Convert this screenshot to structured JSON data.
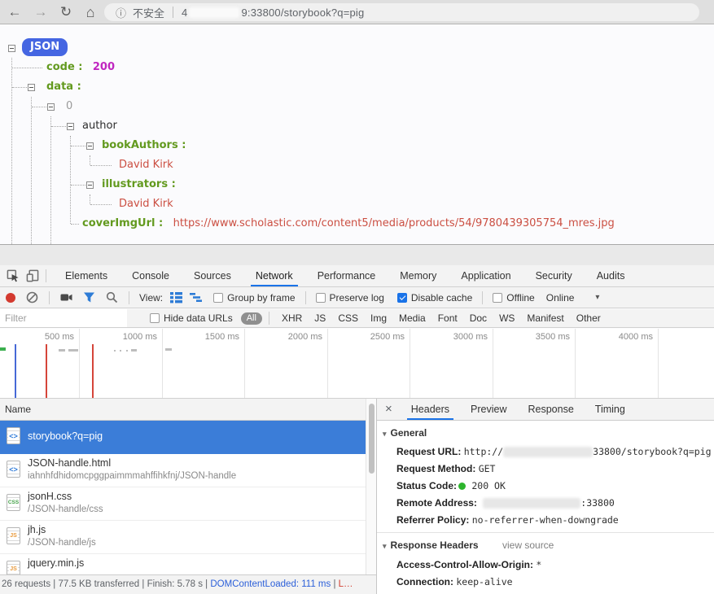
{
  "browser": {
    "security_label": "不安全",
    "url_visible_prefix": "4",
    "url_visible_suffix": "9:33800/storybook?q=pig"
  },
  "icons": {
    "back": "←",
    "forward": "→",
    "reload": "↻",
    "home": "⌂",
    "info": "ⓘ",
    "close": "×",
    "dropdown": "▾",
    "disclosure": "▾"
  },
  "json_tree": {
    "root": "JSON",
    "code_key": "code :",
    "code_value": "200",
    "data_key": "data :",
    "index_key": "0",
    "author_key": "author",
    "book_authors_key": "bookAuthors :",
    "book_authors_value": "David Kirk",
    "illustrators_key": "illustrators :",
    "illustrators_value": "David Kirk",
    "cover_img_key": "coverImgUrl :",
    "cover_img_value": "https://www.scholastic.com/content5/media/products/54/9780439305754_mres.jpg"
  },
  "devtools": {
    "tabs": [
      "Elements",
      "Console",
      "Sources",
      "Network",
      "Performance",
      "Memory",
      "Application",
      "Security",
      "Audits"
    ],
    "active_tab": "Network",
    "network_toolbar": {
      "view_label": "View:",
      "group_by_frame_label": "Group by frame",
      "preserve_log_label": "Preserve log",
      "disable_cache_label": "Disable cache",
      "offline_label": "Offline",
      "throttling_value": "Online"
    },
    "filter_bar": {
      "filter_placeholder": "Filter",
      "hide_data_urls_label": "Hide data URLs",
      "all_label": "All",
      "type_filters": [
        "XHR",
        "JS",
        "CSS",
        "Img",
        "Media",
        "Font",
        "Doc",
        "WS",
        "Manifest",
        "Other"
      ]
    },
    "timeline_ticks": [
      "500 ms",
      "1000 ms",
      "1500 ms",
      "2000 ms",
      "2500 ms",
      "3000 ms",
      "3500 ms",
      "4000 ms"
    ],
    "requests": {
      "name_header": "Name",
      "rows": [
        {
          "name": "storybook?q=pig",
          "path": "",
          "icon_text": "<>"
        },
        {
          "name": "JSON-handle.html",
          "path": "iahnhfdhidomcpggpaimmmahffihkfnj/JSON-handle",
          "icon_text": "<>"
        },
        {
          "name": "jsonH.css",
          "path": "/JSON-handle/css",
          "icon_text": "CSS"
        },
        {
          "name": "jh.js",
          "path": "/JSON-handle/js",
          "icon_text": "JS"
        },
        {
          "name": "jquery.min.js",
          "path": "",
          "icon_text": "JS"
        }
      ]
    },
    "details": {
      "tabs": [
        "Headers",
        "Preview",
        "Response",
        "Timing"
      ],
      "active_tab": "Headers",
      "general_title": "General",
      "request_url_label": "Request URL:",
      "request_url_prefix": "http://",
      "request_url_suffix": "33800/storybook?q=pig",
      "request_method_label": "Request Method:",
      "request_method_value": "GET",
      "status_code_label": "Status Code:",
      "status_code_value": "200 OK",
      "remote_address_label": "Remote Address:",
      "remote_address_suffix": ":33800",
      "referrer_policy_label": "Referrer Policy:",
      "referrer_policy_value": "no-referrer-when-downgrade",
      "response_headers_title": "Response Headers",
      "view_source_label": "view source",
      "acao_label": "Access-Control-Allow-Origin:",
      "acao_value": "*",
      "connection_label": "Connection:",
      "connection_value": "keep-alive"
    },
    "summary_bar": {
      "requests_summary": "26 requests | 77.5 KB transferred | Finish: 5.78 s",
      "separator": " | ",
      "dom_content_loaded": "DOMContentLoaded: 111 ms",
      "load": "L…"
    }
  },
  "colors": {
    "accent_blue": "#1a73e8",
    "selected_row_blue": "#3b7dd8",
    "json_root_pill_blue": "#4566e2",
    "json_key_green": "#639a1f",
    "json_value_red": "#cb4f42",
    "json_number_magenta": "#c026c0",
    "status_ok_green": "#2db52d",
    "dcl_marker_blue": "#2b5fd9",
    "load_marker_red": "#d23f31"
  }
}
